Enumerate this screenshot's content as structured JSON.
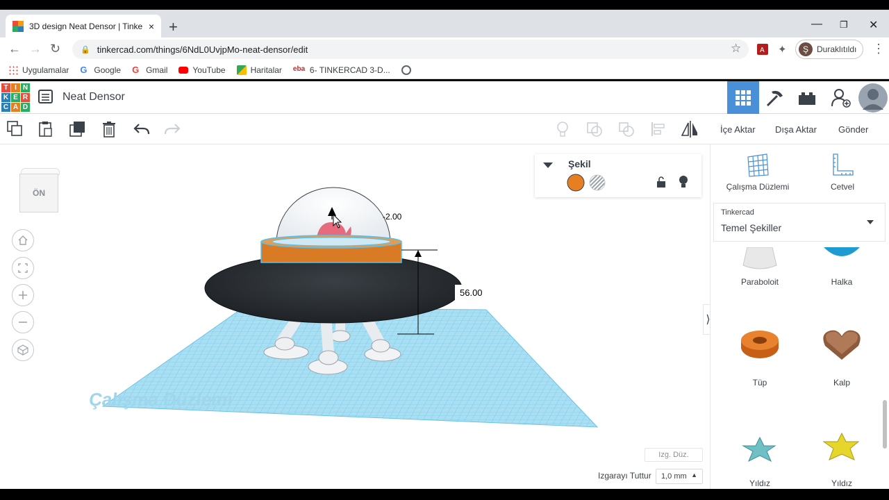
{
  "browser": {
    "tab_title": "3D design Neat Densor | Tinkercad",
    "tab_close": "×",
    "new_tab": "+",
    "url": "tinkercad.com/things/6NdL0UvjpMo-neat-densor/edit",
    "profile_initial": "Ş",
    "profile_label": "Duraklıtıldı",
    "bookmarks": [
      {
        "label": "Uygulamalar",
        "icon": "apps-grid-icon"
      },
      {
        "label": "Google",
        "icon": "google-icon"
      },
      {
        "label": "Gmail",
        "icon": "gmail-icon"
      },
      {
        "label": "YouTube",
        "icon": "youtube-icon"
      },
      {
        "label": "Haritalar",
        "icon": "maps-icon"
      },
      {
        "label": "6- TINKERCAD 3-D...",
        "icon": "eba-icon"
      }
    ]
  },
  "app": {
    "logo_letters": [
      "T",
      "I",
      "N",
      "K",
      "E",
      "R",
      "C",
      "A",
      "D"
    ],
    "design_name": "Neat Densor"
  },
  "toolbar": {
    "import": "İçe Aktar",
    "export": "Dışa Aktar",
    "send": "Gönder"
  },
  "workspace": {
    "viewcube_label": "ÖN",
    "shape_panel_title": "Şekil",
    "dim_height": "56.00",
    "dim_offset": "-2.00",
    "plane_watermark": "Çalışma Düzlemi",
    "grid_button": "Izg. Düz.",
    "snap_label": "Izgarayı Tuttur",
    "snap_value": "1,0 mm"
  },
  "right_panel": {
    "workplane": "Çalışma Düzlemi",
    "ruler": "Cetvel",
    "library_small": "Tinkercad",
    "library_main": "Temel Şekiller",
    "shapes": [
      {
        "label": "Paraboloit"
      },
      {
        "label": "Halka"
      },
      {
        "label": "Tüp"
      },
      {
        "label": "Kalp"
      },
      {
        "label": "Yıldız"
      },
      {
        "label": "Yıldız"
      }
    ]
  },
  "colors": {
    "accent_blue": "#4a90d9",
    "shape_orange": "#e67e22",
    "saucer_dark": "#2b2f33",
    "grid_blue": "#8fd4ef"
  }
}
